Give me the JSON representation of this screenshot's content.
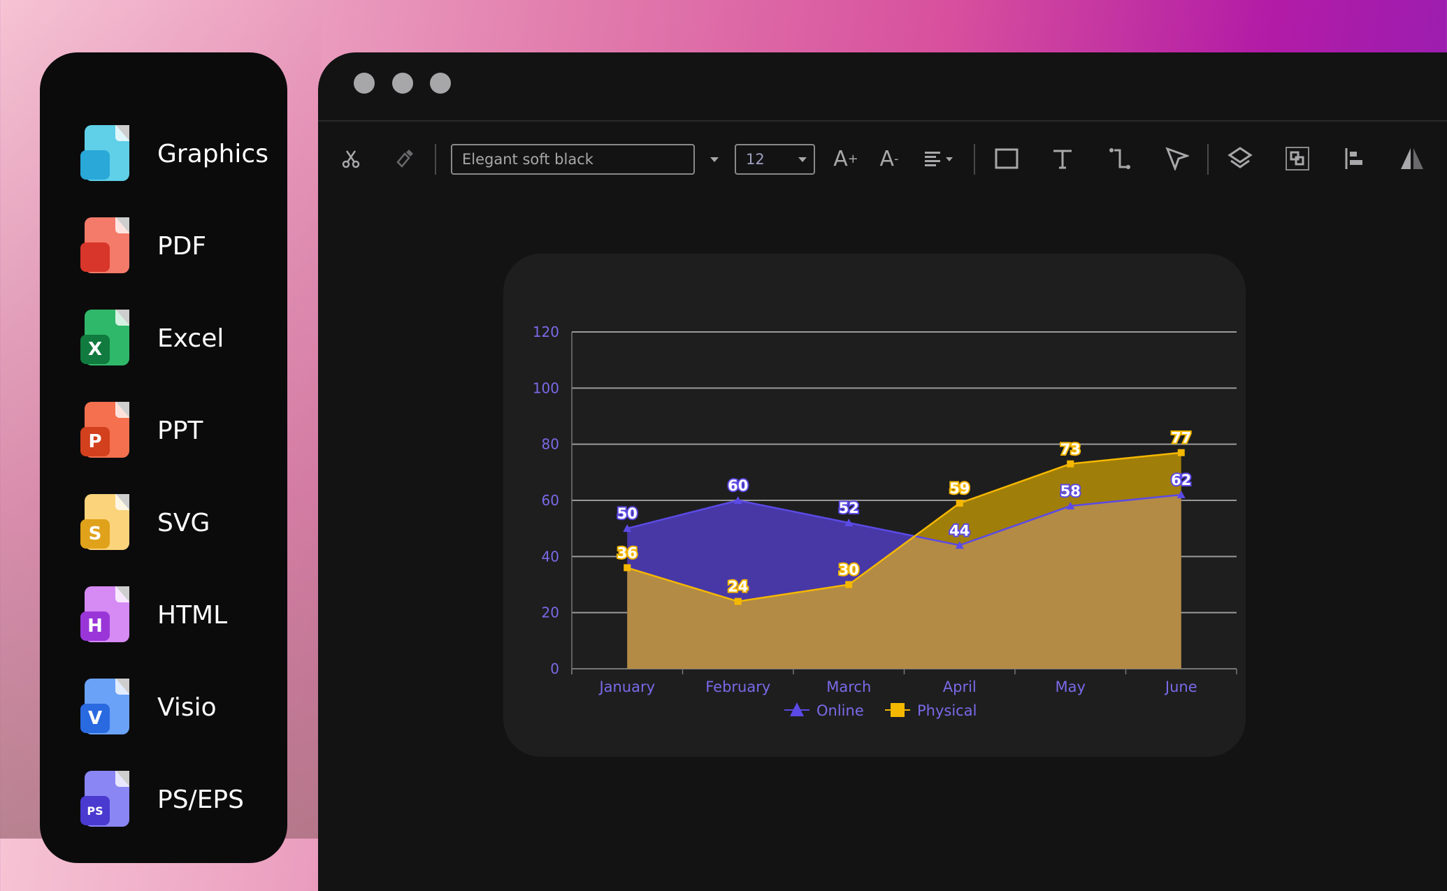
{
  "sidebar": {
    "items": [
      {
        "label": "Graphics",
        "icon": "image-file-icon",
        "badge": "",
        "color": "#5fd0e8",
        "badge_color": "#2aa8d8"
      },
      {
        "label": "PDF",
        "icon": "pdf-file-icon",
        "badge": "",
        "color": "#f47a6a",
        "badge_color": "#d8362a"
      },
      {
        "label": "Excel",
        "icon": "excel-file-icon",
        "badge": "X",
        "color": "#2fb86a",
        "badge_color": "#117a3e"
      },
      {
        "label": "PPT",
        "icon": "ppt-file-icon",
        "badge": "P",
        "color": "#f4704e",
        "badge_color": "#d2401e"
      },
      {
        "label": "SVG",
        "icon": "svg-file-icon",
        "badge": "S",
        "color": "#fbd37a",
        "badge_color": "#e0a21a"
      },
      {
        "label": "HTML",
        "icon": "html-file-icon",
        "badge": "H",
        "color": "#d68af4",
        "badge_color": "#9a36d8"
      },
      {
        "label": "Visio",
        "icon": "visio-file-icon",
        "badge": "V",
        "color": "#6aa2f8",
        "badge_color": "#2a6ae0"
      },
      {
        "label": "PS/EPS",
        "icon": "ps-file-icon",
        "badge": "PS",
        "color": "#8a86f4",
        "badge_color": "#4a3ad0"
      }
    ]
  },
  "toolbar": {
    "font_value": "Elegant soft black",
    "font_size": "12"
  },
  "chart_data": {
    "type": "area",
    "categories": [
      "January",
      "February",
      "March",
      "April",
      "May",
      "June"
    ],
    "series": [
      {
        "name": "Online",
        "values": [
          50,
          60,
          52,
          44,
          58,
          62
        ],
        "color": "#5b4ae6",
        "marker": "triangle"
      },
      {
        "name": "Physical",
        "values": [
          36,
          24,
          30,
          59,
          73,
          77
        ],
        "color": "#f5b800",
        "marker": "square"
      }
    ],
    "ylim": [
      0,
      120
    ],
    "yticks": [
      0,
      20,
      40,
      60,
      80,
      100,
      120
    ],
    "grid": true,
    "legend": "bottom",
    "data_labels": true
  }
}
